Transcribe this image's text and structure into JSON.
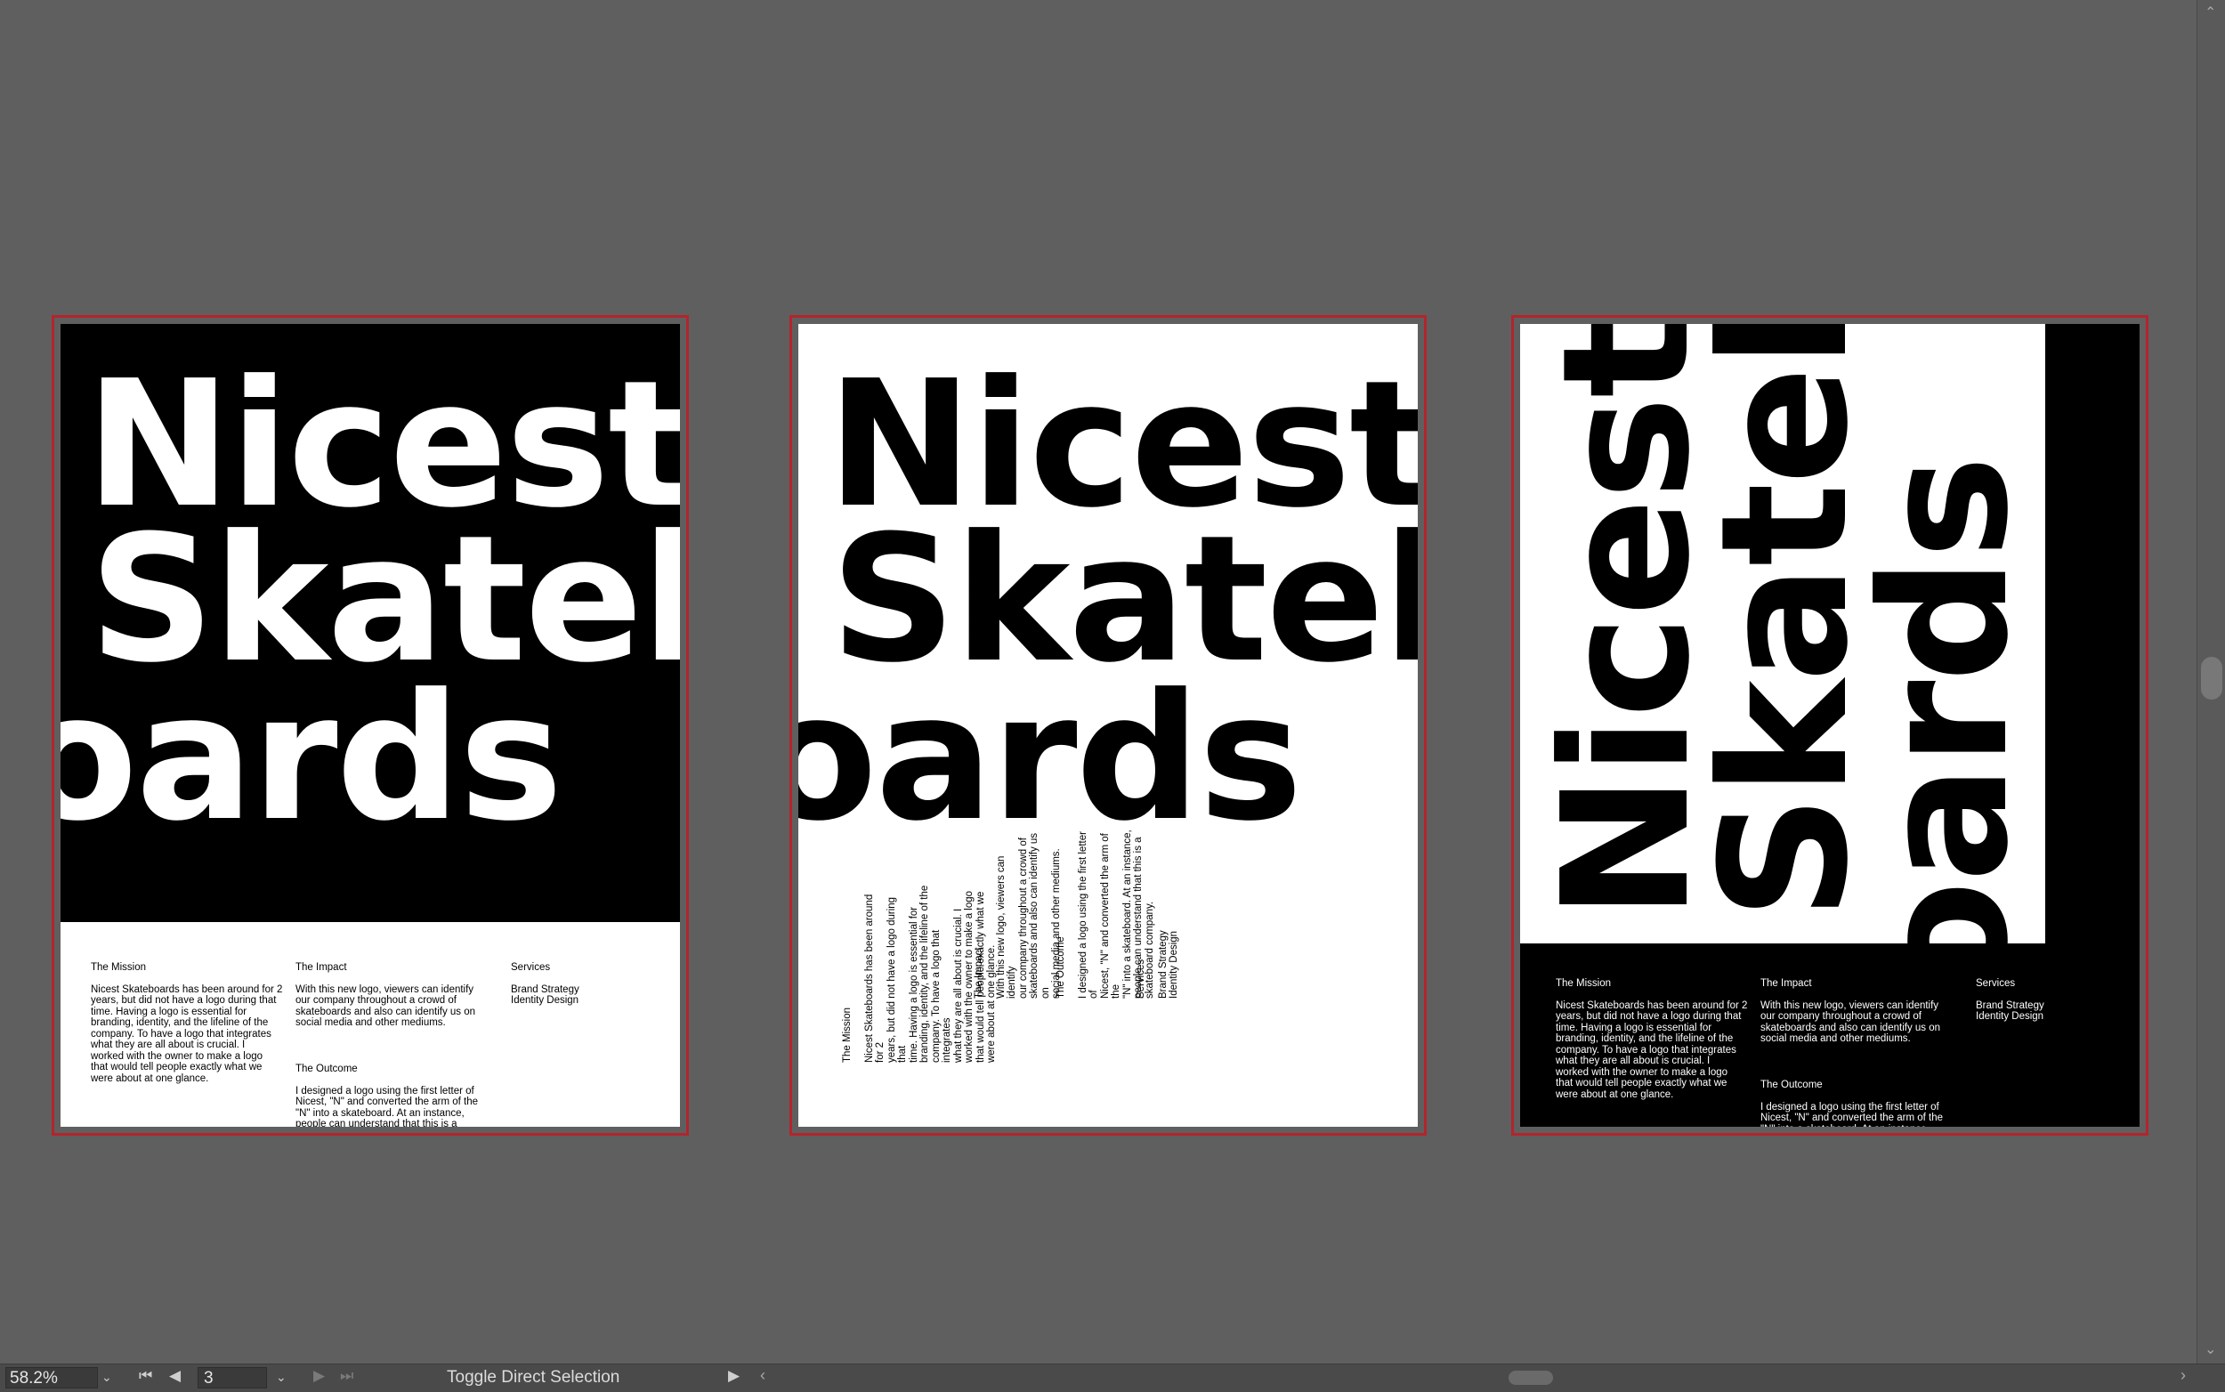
{
  "title_words": [
    "Nicest",
    "Skateb",
    "oards"
  ],
  "copy": {
    "mission_heading": "The Mission",
    "mission_text": "Nicest Skateboards has been around for 2\nyears, but did not have a logo during that\ntime. Having a logo is essential for\nbranding, identity, and the lifeline of the\ncompany. To have a logo that integrates\nwhat they are all about is crucial. I\nworked with the owner to make a logo\nthat would tell people exactly what we\nwere about at one glance.",
    "impact_heading": "The Impact",
    "impact_text": "With this new logo, viewers can identify\nour company throughout a crowd of\nskateboards and also can identify us on\nsocial media and other mediums.",
    "outcome_heading": "The Outcome",
    "outcome_text": "I designed a logo using the first letter of\nNicest, \"N\" and converted the arm of the\n\"N\" into a skateboard. At an instance,\npeople can understand that this is a\nskateboard company.",
    "services_heading": "Services",
    "services_items": "Brand Strategy\nIdentity Design"
  },
  "status_bar": {
    "zoom": "58.2%",
    "page": "3",
    "tool_label": "Toggle Direct Selection"
  },
  "colors": {
    "canvas": "#5f5f5f",
    "artboard_border": "#b3242d"
  }
}
